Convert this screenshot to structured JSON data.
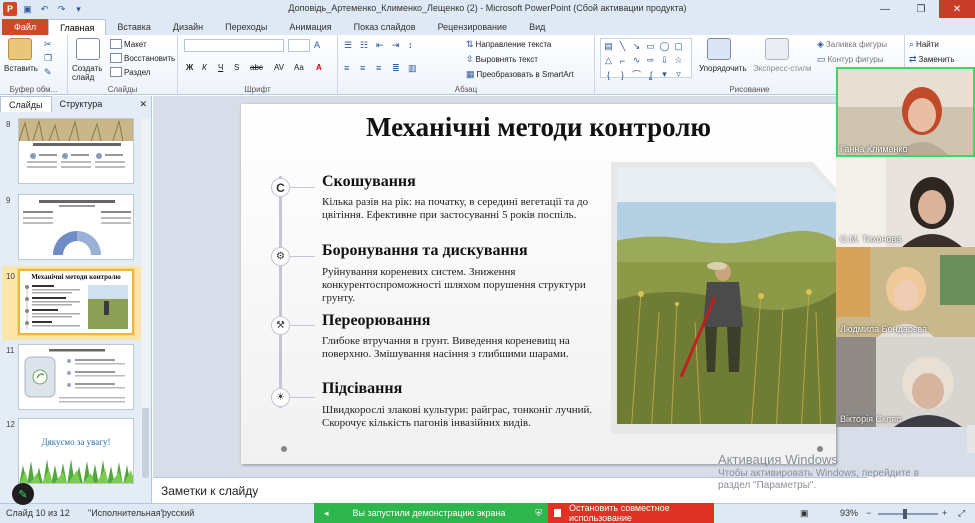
{
  "window": {
    "title": "Доповідь_Артеменко_Клименко_Лещенко (2)  -  Microsoft PowerPoint (Сбой активации продукта)"
  },
  "ribbon_tabs": [
    {
      "label": "Файл"
    },
    {
      "label": "Главная"
    },
    {
      "label": "Вставка"
    },
    {
      "label": "Дизайн"
    },
    {
      "label": "Переходы"
    },
    {
      "label": "Анимация"
    },
    {
      "label": "Показ слайдов"
    },
    {
      "label": "Рецензирование"
    },
    {
      "label": "Вид"
    }
  ],
  "ribbon": {
    "paste": "Вставить",
    "clipboard": "Буфер обм...",
    "new_slide": "Создать слайд",
    "layout": "Макет",
    "reset": "Восстановить",
    "section": "Раздел",
    "slides_group": "Слайды",
    "font_group": "Шрифт",
    "text_direction": "Направление текста",
    "align_text": "Выровнять текст",
    "smartart": "Преобразовать в SmartArt",
    "paragraph_group": "Абзац",
    "arrange": "Упорядочить",
    "quick_styles": "Экспресс-стили",
    "shape_fill": "Заливка фигуры",
    "shape_outline": "Контур фигуры",
    "drawing_group": "Рисование",
    "find": "Найти",
    "replace": "Заменить"
  },
  "left_pane": {
    "tab_slides": "Слайды",
    "tab_outline": "Структура",
    "thumbnails": [
      {
        "num": "8"
      },
      {
        "num": "9"
      },
      {
        "num": "10",
        "title": "Механічні методи контролю"
      },
      {
        "num": "11"
      },
      {
        "num": "12",
        "text": "Дякуємо за увагу!"
      }
    ]
  },
  "slide": {
    "title": "Механічні методи контролю",
    "items": [
      {
        "icon": "C",
        "heading": "Скошування",
        "text": "Кілька разів на рік: на початку, в середині вегетації та до цвітіння. Ефективне при застосуванні 5 років поспіль."
      },
      {
        "icon": "⚙",
        "heading": "Боронування та дискування",
        "text": "Руйнування кореневих систем. Зниження конкурентоспроможності шляхом порушення структури грунту."
      },
      {
        "icon": "⚒",
        "heading": "Переорювання",
        "text": "Глибоке втручання в грунт. Виведення кореневищ на поверхню. Змішування насіння з глибшими шарами."
      },
      {
        "icon": "☀",
        "heading": "Підсівання",
        "text": "Швидкорослі злакові культури: райграс, тонконіг лучний. Скорочує кількість пагонів інвазійних видів."
      }
    ]
  },
  "notes": {
    "placeholder": "Заметки к слайду"
  },
  "activation": {
    "line1": "Активация Windows",
    "line2": "Чтобы активировать Windows, перейдите в раздел \"Параметры\"."
  },
  "status": {
    "slide_of": "Слайд 10 из 12",
    "theme": "\"Исполнительная\"",
    "language": "русский",
    "zoom": "93%"
  },
  "share": {
    "running": "Вы запустили демонстрацию экрана",
    "stop": "Остановить совместное использование"
  },
  "participants": [
    {
      "name": "Ганна Клименко"
    },
    {
      "name": "О.М. Тихонова"
    },
    {
      "name": "Людмила Бондарєва"
    },
    {
      "name": "Вікторія Скляр"
    }
  ],
  "colors": {
    "file_tab": "#d24726",
    "share_green": "#2db64b",
    "share_red": "#e03224",
    "active_speaker": "#3dd66b"
  }
}
